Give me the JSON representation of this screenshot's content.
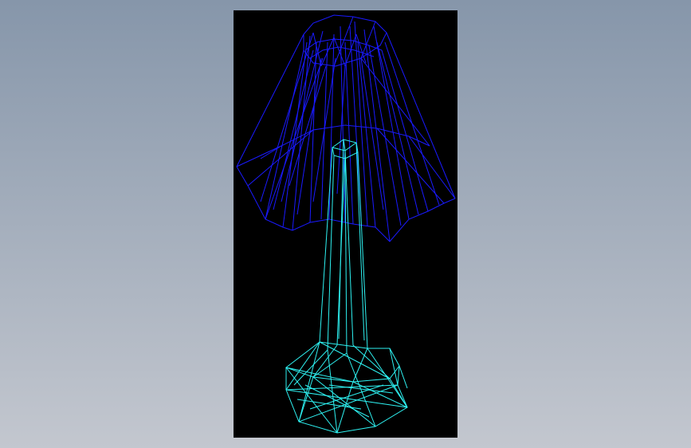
{
  "scene": {
    "background_top_color": "#8696aa",
    "background_bottom_color": "#c3c7cf",
    "viewport_color": "#000000",
    "model": {
      "shade_color": "#1a1aff",
      "base_color": "#2ef2f2",
      "render_mode": "wireframe"
    }
  }
}
